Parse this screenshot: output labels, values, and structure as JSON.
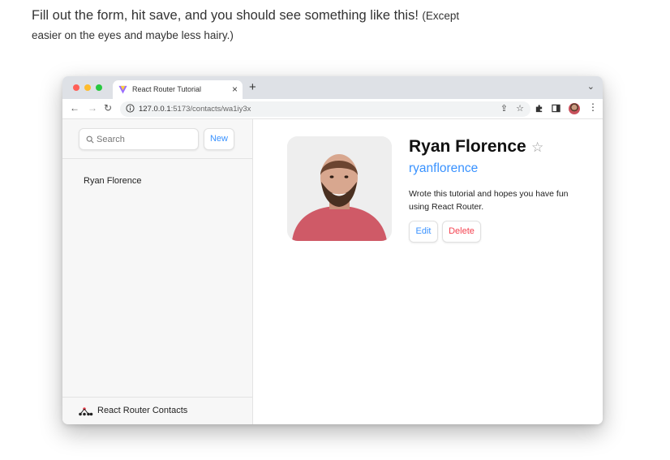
{
  "intro": {
    "main_text": "Fill out the form, hit save, and you should see something like this!",
    "aside_text": "(Except easier on the eyes and maybe less hairy.)"
  },
  "browser": {
    "tab": {
      "title": "React Router Tutorial",
      "close": "×",
      "favicon": "vite-logo-icon"
    },
    "new_tab": "+",
    "tab_menu": "⌄",
    "nav": {
      "back": "←",
      "forward": "→",
      "reload": "↻"
    },
    "url": {
      "host": "127.0.0.1",
      "path": ":5173/contacts/wa1iy3x"
    },
    "icons": [
      "share-icon",
      "bookmark-star-icon",
      "extensions-icon",
      "side-panel-icon",
      "profile-avatar",
      "more-menu-icon"
    ]
  },
  "sidebar": {
    "search_placeholder": "Search",
    "new_label": "New",
    "contacts": [
      {
        "name": "Ryan Florence"
      }
    ],
    "footer_brand": "React Router Contacts"
  },
  "contact": {
    "name": "Ryan Florence",
    "favorite_glyph": "☆",
    "favorite": false,
    "twitter": "ryanflorence",
    "notes": "Wrote this tutorial and hopes you have fun using React Router.",
    "edit_label": "Edit",
    "delete_label": "Delete"
  },
  "colors": {
    "accent": "#3992ff",
    "danger": "#f44250",
    "sidebar_bg": "#f7f7f7"
  }
}
